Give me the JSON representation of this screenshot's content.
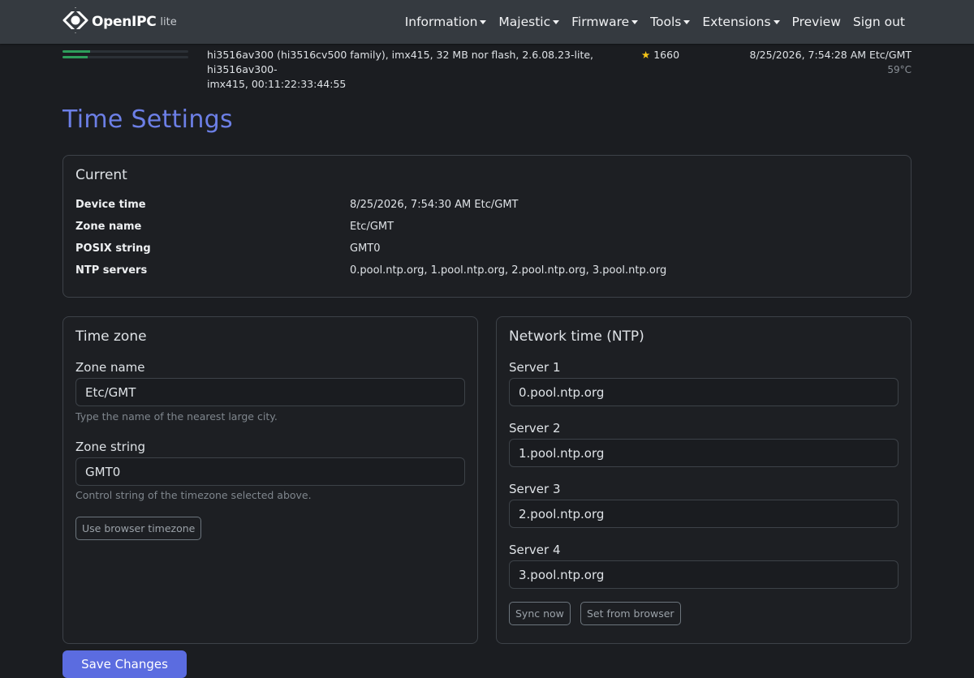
{
  "brand": {
    "name": "OpenIPC",
    "suffix": "lite"
  },
  "nav": {
    "items": [
      {
        "label": "Information",
        "dropdown": true
      },
      {
        "label": "Majestic",
        "dropdown": true
      },
      {
        "label": "Firmware",
        "dropdown": true
      },
      {
        "label": "Tools",
        "dropdown": true
      },
      {
        "label": "Extensions",
        "dropdown": true
      },
      {
        "label": "Preview",
        "dropdown": false
      },
      {
        "label": "Sign out",
        "dropdown": false
      }
    ]
  },
  "status": {
    "sysinfo_line1": "hi3516av300 (hi3516cv500 family), imx415, 32 MB nor flash, 2.6.08.23-lite, hi3516av300-",
    "sysinfo_line2": "imx415, 00:11:22:33:44:55",
    "star_icon": "star-icon",
    "stars": "1660",
    "datetime": "8/25/2026, 7:54:28 AM Etc/GMT",
    "temperature": "59°C",
    "progress": [
      0.22,
      0.2
    ]
  },
  "page": {
    "title": "Time Settings"
  },
  "current": {
    "heading": "Current",
    "rows": [
      {
        "key": "Device time",
        "value": "8/25/2026, 7:54:30 AM Etc/GMT"
      },
      {
        "key": "Zone name",
        "value": "Etc/GMT"
      },
      {
        "key": "POSIX string",
        "value": "GMT0"
      },
      {
        "key": "NTP servers",
        "value": "0.pool.ntp.org, 1.pool.ntp.org, 2.pool.ntp.org, 3.pool.ntp.org"
      }
    ]
  },
  "timezone": {
    "heading": "Time zone",
    "zone_name_label": "Zone name",
    "zone_name_value": "Etc/GMT",
    "zone_name_help": "Type the name of the nearest large city.",
    "zone_string_label": "Zone string",
    "zone_string_value": "GMT0",
    "zone_string_help": "Control string of the timezone selected above.",
    "browser_button": "Use browser timezone"
  },
  "ntp": {
    "heading": "Network time (NTP)",
    "servers": [
      {
        "label": "Server 1",
        "value": "0.pool.ntp.org"
      },
      {
        "label": "Server 2",
        "value": "1.pool.ntp.org"
      },
      {
        "label": "Server 3",
        "value": "2.pool.ntp.org"
      },
      {
        "label": "Server 4",
        "value": "3.pool.ntp.org"
      }
    ],
    "sync_button": "Sync now",
    "browser_button": "Set from browser"
  },
  "save_button": "Save Changes",
  "colors": {
    "accent": "#6c7fe6",
    "primary_button": "#5b6ce0",
    "progress": "#2e9e5b",
    "navbar": "#353a40",
    "background": "#1b1d21"
  }
}
